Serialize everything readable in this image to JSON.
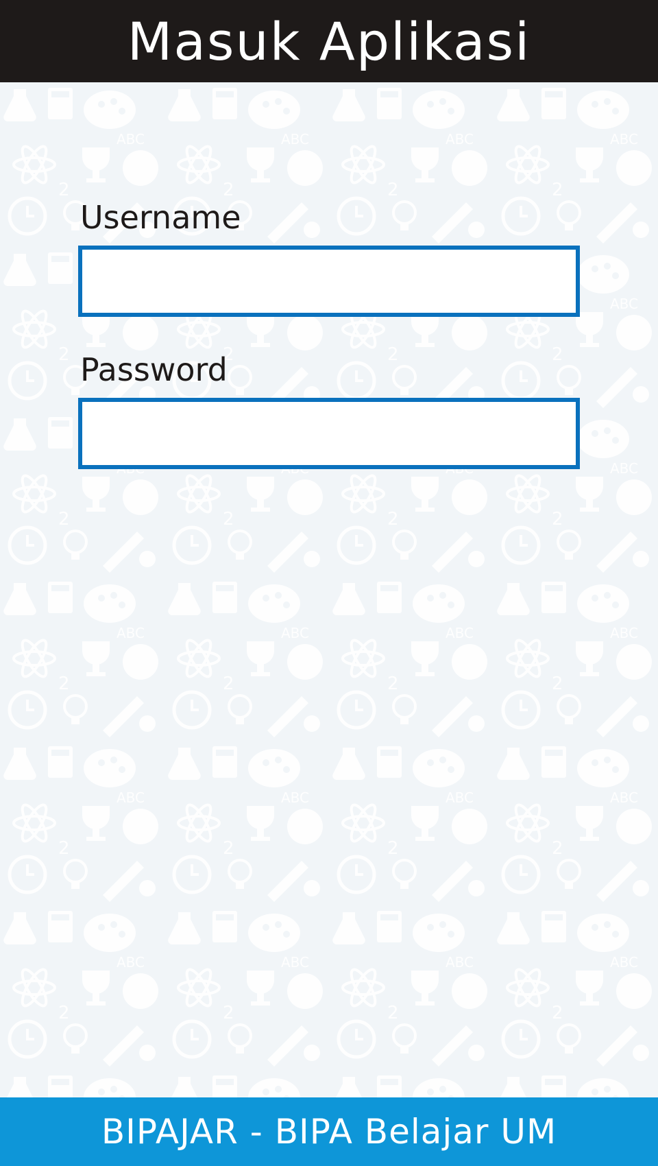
{
  "header": {
    "title": "Masuk Aplikasi"
  },
  "form": {
    "username_label": "Username",
    "username_value": "",
    "password_label": "Password",
    "password_value": ""
  },
  "footer": {
    "text": "BIPAJAR - BIPA Belajar UM"
  },
  "colors": {
    "header_bg": "#1e1a19",
    "footer_bg": "#0e96d8",
    "input_border": "#0a71bd",
    "page_bg": "#f1f5f8"
  },
  "background_icons": [
    "flask-icon",
    "calculator-icon",
    "palette-icon",
    "atom-icon",
    "trophy-icon",
    "globe-icon",
    "lightbulb-icon",
    "clock-icon",
    "apple-icon",
    "pencil-icon",
    "book-icon",
    "magnifier-icon",
    "rocket-icon",
    "graduation-cap-icon",
    "microscope-icon",
    "basketball-icon"
  ]
}
